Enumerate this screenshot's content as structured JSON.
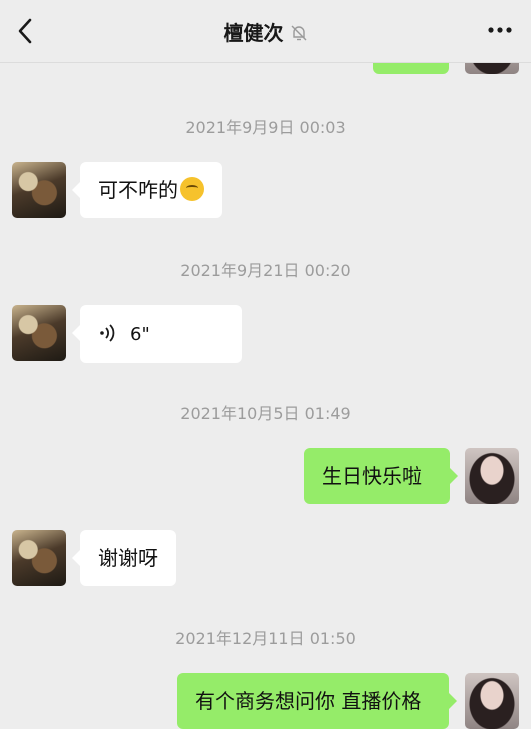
{
  "header": {
    "title": "檀健次",
    "back_icon": "chevron-left-icon",
    "mute_icon": "bell-off-icon",
    "more_icon": "more-dots-icon"
  },
  "messages": {
    "ts1": "2021年9月9日 00:03",
    "m1": "可不咋的",
    "ts2": "2021年9月21日 00:20",
    "voice_duration": "6\"",
    "ts3": "2021年10月5日 01:49",
    "m3": "生日快乐啦",
    "m4": "谢谢呀",
    "ts4": "2021年12月11日 01:50",
    "m5": "有个商务想问你 直播价格"
  },
  "colors": {
    "background": "#ededed",
    "sent_bubble": "#95ec69",
    "received_bubble": "#ffffff",
    "timestamp": "#9c9c9c"
  }
}
